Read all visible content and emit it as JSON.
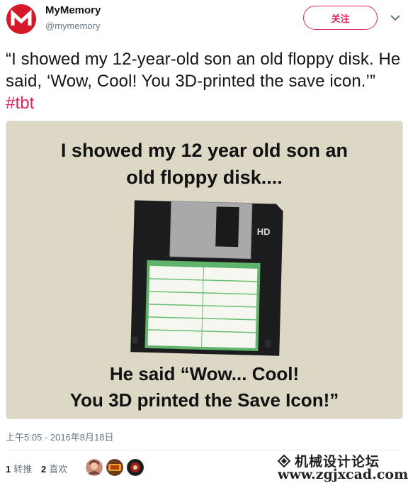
{
  "header": {
    "display_name": "MyMemory",
    "handle": "@mymemory",
    "follow_label": "关注",
    "brand_color": "#d7172a",
    "accent_color": "#e0245e"
  },
  "tweet": {
    "text": "“I showed my 12-year-old son an old floppy disk. He said, ‘Wow, Cool! You 3D-printed the save icon.’”",
    "hashtag": "#tbt"
  },
  "media": {
    "caption_top_line1": "I showed my 12 year old son an",
    "caption_top_line2": "old floppy disk....",
    "caption_bottom_line1": "He said “Wow... Cool!",
    "caption_bottom_line2": "You 3D printed the Save Icon!”",
    "disk_label": "HD",
    "background_color": "#dcd8c5"
  },
  "timestamp": "上午5:05 - 2016年8月18日",
  "stats": {
    "retweets_count": "1",
    "retweets_label": "转推",
    "likes_count": "2",
    "likes_label": "喜欢"
  },
  "watermark": {
    "cn": "机械设计论坛",
    "url": "www.zgjxcad.com"
  },
  "icons": {
    "more": "chevron-down-icon",
    "avatar": "mymemory-logo-icon"
  }
}
